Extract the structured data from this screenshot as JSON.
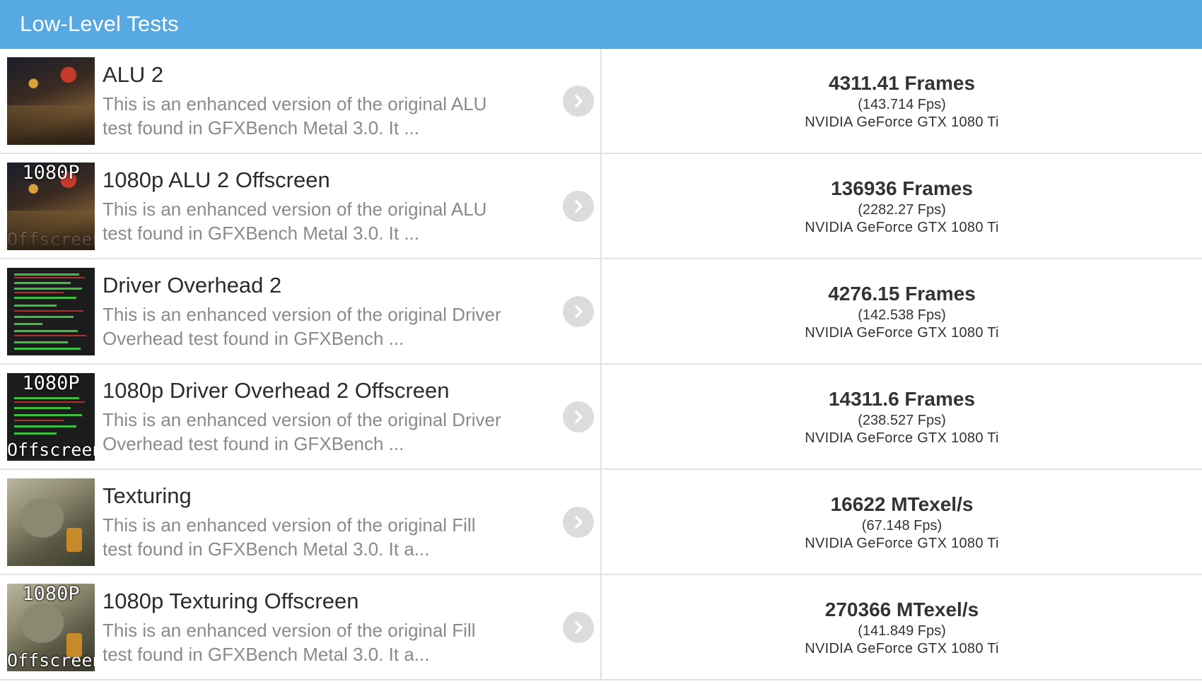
{
  "header": {
    "title": "Low-Level Tests"
  },
  "tests": [
    {
      "title": "ALU 2",
      "description_line1": "This is an enhanced version of the original ALU",
      "description_line2": "test found in GFXBench Metal 3.0. It ...",
      "score": "4311.41 Frames",
      "fps": "(143.714 Fps)",
      "gpu": "NVIDIA GeForce GTX 1080 Ti",
      "thumb_top": "",
      "thumb_bottom": ""
    },
    {
      "title": "1080p ALU 2 Offscreen",
      "description_line1": "This is an enhanced version of the original ALU",
      "description_line2": "test found in GFXBench Metal 3.0. It ...",
      "score": "136936 Frames",
      "fps": "(2282.27 Fps)",
      "gpu": "NVIDIA GeForce GTX 1080 Ti",
      "thumb_top": "1080P",
      "thumb_bottom": "Offscreen"
    },
    {
      "title": "Driver Overhead 2",
      "description_line1": "This is an enhanced version of the original Driver",
      "description_line2": "Overhead test found in GFXBench ...",
      "score": "4276.15 Frames",
      "fps": "(142.538 Fps)",
      "gpu": "NVIDIA GeForce GTX 1080 Ti",
      "thumb_top": "",
      "thumb_bottom": ""
    },
    {
      "title": "1080p Driver Overhead 2 Offscreen",
      "description_line1": "This is an enhanced version of the original Driver",
      "description_line2": "Overhead test found in GFXBench ...",
      "score": "14311.6 Frames",
      "fps": "(238.527 Fps)",
      "gpu": "NVIDIA GeForce GTX 1080 Ti",
      "thumb_top": "1080P",
      "thumb_bottom": "Offscreen"
    },
    {
      "title": "Texturing",
      "description_line1": "This is an enhanced version of the original Fill",
      "description_line2": "test found in GFXBench Metal 3.0. It a...",
      "score": "16622 MTexel/s",
      "fps": "(67.148 Fps)",
      "gpu": "NVIDIA GeForce GTX 1080 Ti",
      "thumb_top": "",
      "thumb_bottom": ""
    },
    {
      "title": "1080p Texturing Offscreen",
      "description_line1": "This is an enhanced version of the original Fill",
      "description_line2": "test found in GFXBench Metal 3.0. It a...",
      "score": "270366 MTexel/s",
      "fps": "(141.849 Fps)",
      "gpu": "NVIDIA GeForce GTX 1080 Ti",
      "thumb_top": "1080P",
      "thumb_bottom": "Offscreen"
    }
  ],
  "icons": {
    "row_arrow": "chevron-right-icon"
  },
  "colors": {
    "header_bg": "#57a9e4",
    "divider": "#e2e2e2",
    "arrow_bg": "#dcdcdc"
  }
}
